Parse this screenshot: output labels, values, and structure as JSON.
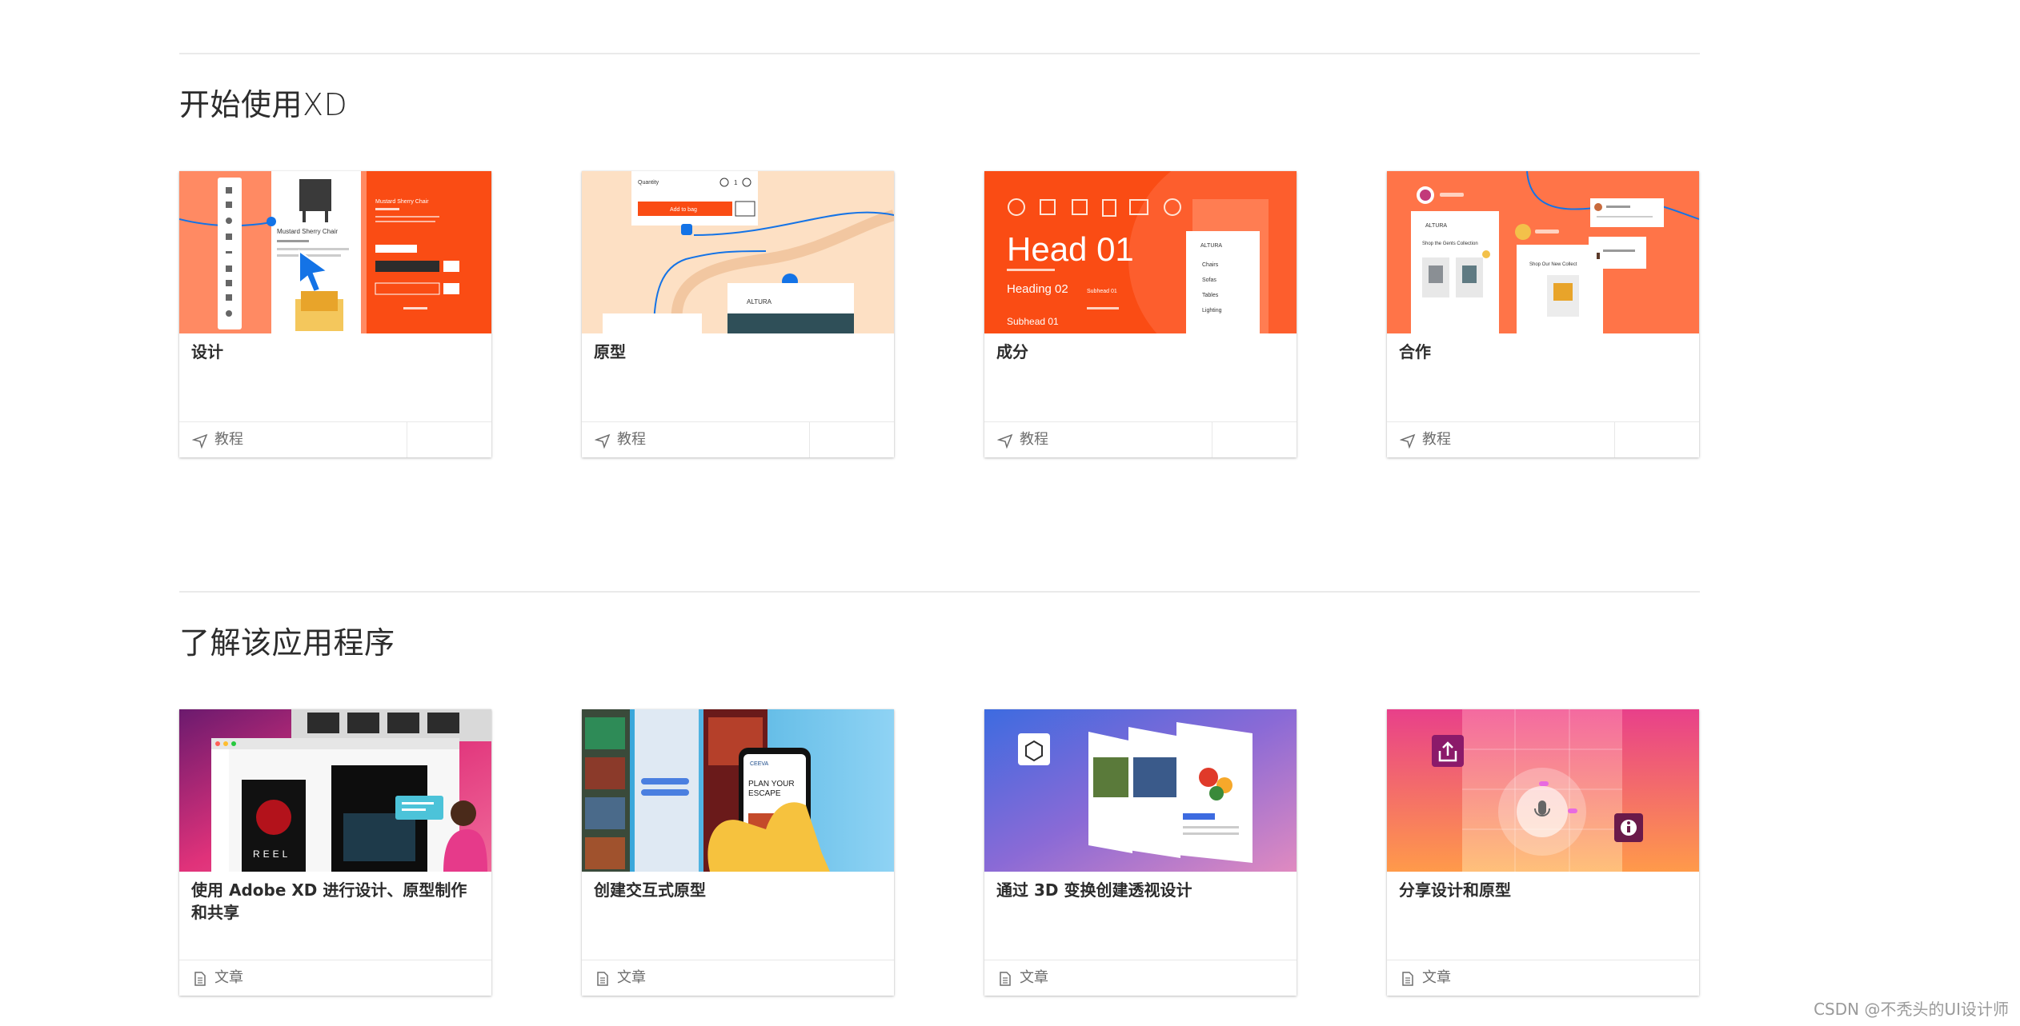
{
  "sections": [
    {
      "title": "开始使用XD",
      "cards": [
        {
          "title": "设计",
          "type_label": "教程",
          "type_icon": "tutorial-icon"
        },
        {
          "title": "原型",
          "type_label": "教程",
          "type_icon": "tutorial-icon"
        },
        {
          "title": "成分",
          "type_label": "教程",
          "type_icon": "tutorial-icon"
        },
        {
          "title": "合作",
          "type_label": "教程",
          "type_icon": "tutorial-icon"
        }
      ]
    },
    {
      "title": "了解该应用程序",
      "cards": [
        {
          "title": "使用 Adobe XD 进行设计、原型制作和共享",
          "type_label": "文章",
          "type_icon": "article-icon"
        },
        {
          "title": "创建交互式原型",
          "type_label": "文章",
          "type_icon": "article-icon"
        },
        {
          "title": "通过 3D 变换创建透视设计",
          "type_label": "文章",
          "type_icon": "article-icon"
        },
        {
          "title": "分享设计和原型",
          "type_label": "文章",
          "type_icon": "article-icon"
        }
      ]
    }
  ],
  "thumb_text": {
    "design_product": "Mustard Sherry Chair",
    "design_product2": "Mustard Sherry Chair",
    "proto_quantity": "Quantity",
    "proto_qty_value": "1",
    "proto_add_bag": "Add to bag",
    "proto_brand": "ALTURA",
    "comp_head": "Head 01",
    "comp_heading": "Heading 02",
    "comp_subhead": "Subhead 01",
    "comp_subhead2": "Subhead 01",
    "comp_brand": "ALTURA",
    "comp_menu": [
      "Chairs",
      "Sofas",
      "Tables",
      "Lighting"
    ],
    "collab_brand": "ALTURA",
    "collab_collection": "Shop the Gents Collection",
    "collab_collection2": "Shop Our New Collect",
    "reel_title": "REEL",
    "escape_line1": "PLAN YOUR",
    "escape_line2": "ESCAPE"
  },
  "watermark": "CSDN @不秃头的UI设计师",
  "colors": {
    "accent_orange": "#fa4c14",
    "peach": "#fde0c4",
    "blue": "#1473e6",
    "text": "#2c2c2c",
    "muted": "#6e6e6e"
  }
}
